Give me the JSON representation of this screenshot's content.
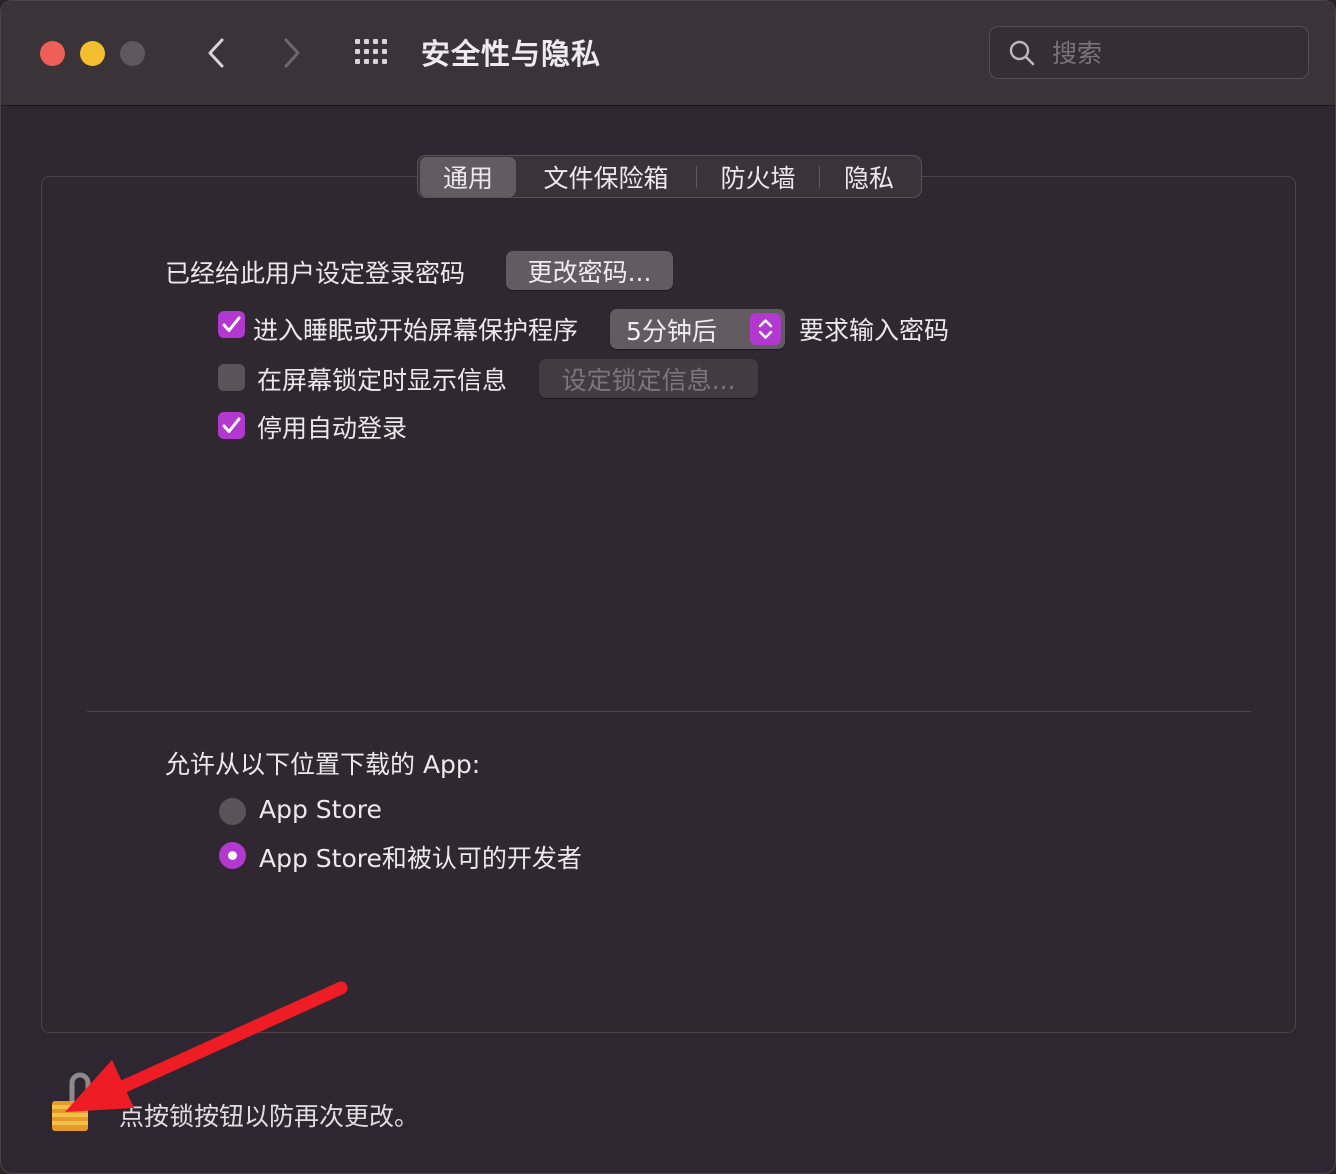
{
  "window": {
    "title": "安全性与隐私",
    "traffic_colors": {
      "close": "#ee5f58",
      "minimize": "#f5be2e",
      "zoom": "#5f585e"
    }
  },
  "search": {
    "placeholder": "搜索"
  },
  "tabs": [
    {
      "label": "通用",
      "active": true
    },
    {
      "label": "文件保险箱",
      "active": false
    },
    {
      "label": "防火墙",
      "active": false
    },
    {
      "label": "隐私",
      "active": false
    }
  ],
  "general": {
    "password_label": "已经给此用户设定登录密码",
    "change_password_button": "更改密码...",
    "require_password": {
      "checked": true,
      "label": "进入睡眠或开始屏幕保护程序",
      "delay_value": "5分钟后",
      "suffix": "要求输入密码"
    },
    "lock_message": {
      "checked": false,
      "label": "在屏幕锁定时显示信息",
      "button": "设定锁定信息..."
    },
    "disable_autologin": {
      "checked": true,
      "label": "停用自动登录"
    }
  },
  "downloads": {
    "heading": "允许从以下位置下载的 App:",
    "options": [
      {
        "label": "App Store",
        "selected": false
      },
      {
        "label": "App Store和被认可的开发者",
        "selected": true
      }
    ]
  },
  "footer": {
    "lock_text": "点按锁按钮以防再次更改。"
  },
  "accent_color": "#b338d0",
  "annotation_color": "#ee1c24"
}
